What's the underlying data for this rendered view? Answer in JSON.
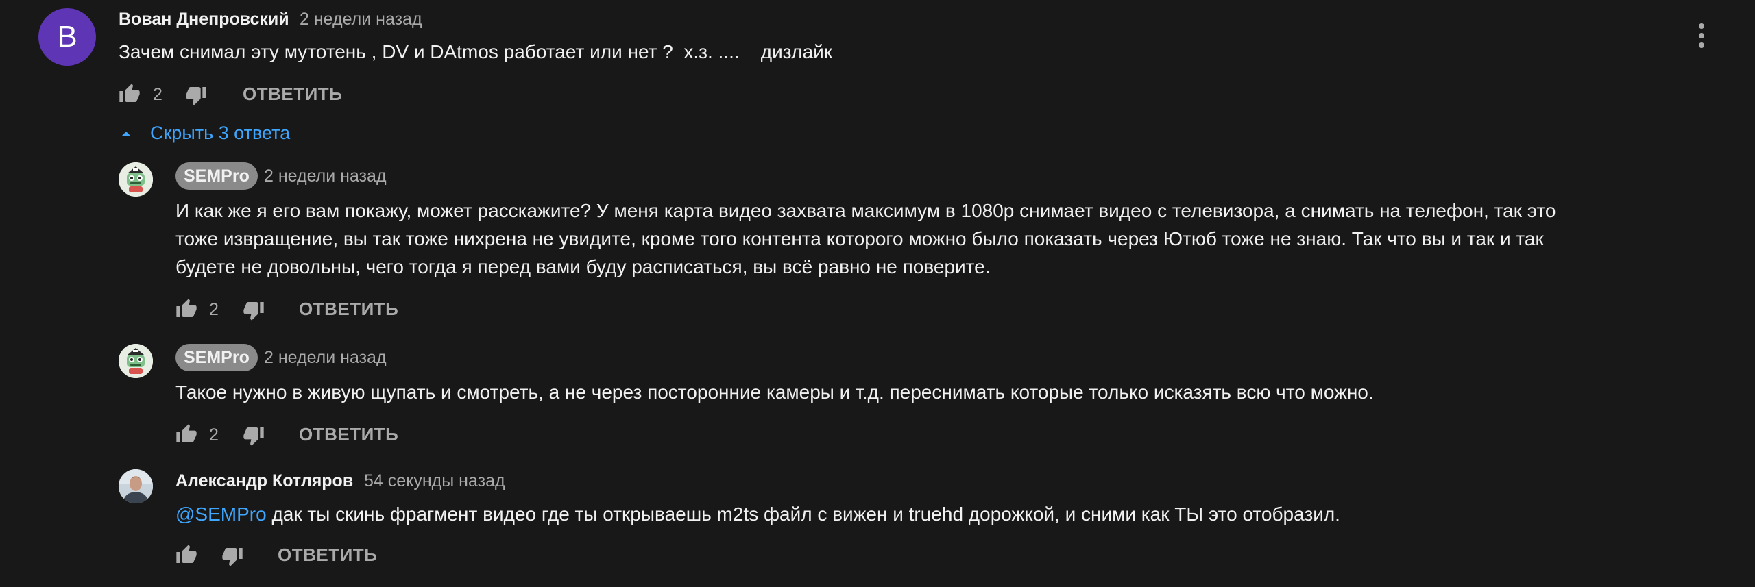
{
  "comment": {
    "avatar_letter": "В",
    "author": "Вован Днепровский",
    "time": "2 недели назад",
    "text": "Зачем снимал эту мутотень , DV и DAtmos работает или нет ?  х.з. ....    дизлайк",
    "likes": "2",
    "reply_label": "ОТВЕТИТЬ",
    "menu_icon": "more-vert-icon"
  },
  "replies_toggle": {
    "label": "Скрыть 3 ответа",
    "icon": "caret-up-icon"
  },
  "replies": [
    {
      "author": "SEMPro",
      "time": "2 недели назад",
      "lines": [
        "И как же я его вам покажу, может расскажите? У меня карта видео захвата максимум в 1080p снимает видео с телевизора, а снимать на телефон, так это",
        "тоже извращение, вы так тоже нихрена не увидите, кроме того контента которого можно было показать через Ютюб тоже не знаю. Так что вы и так и так",
        "будете не довольны, чего тогда я перед вами буду расписаться, вы всё равно не поверите."
      ],
      "likes": "2",
      "reply_label": "ОТВЕТИТЬ"
    },
    {
      "author": "SEMPro",
      "time": "2 недели назад",
      "text": "Такое нужно в живую щупать и смотреть, а не через посторонние камеры и т.д. переснимать которые только исказять всю что можно.",
      "likes": "2",
      "reply_label": "ОТВЕТИТЬ"
    },
    {
      "author": "Александр Котляров",
      "time": "54 секунды назад",
      "mention": "@SEMPro",
      "text": " дак ты скинь фрагмент видео где ты открываешь m2ts файл с вижен и truehd дорожкой, и сними как ТЫ это отобразил.",
      "reply_label": "ОТВЕТИТЬ"
    }
  ],
  "colors": {
    "background": "#181818",
    "link": "#3ea6ff",
    "muted": "#aaaaaa",
    "avatar": "#5d35b5",
    "chip": "#8a8a8a"
  }
}
